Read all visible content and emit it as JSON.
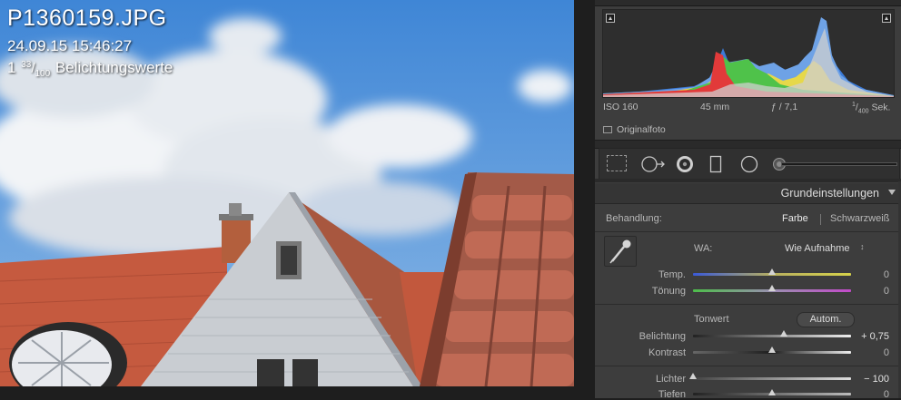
{
  "photo": {
    "filename": "P1360159.JPG",
    "datetime": "24.09.15 15:46:27",
    "exposure_whole": "1",
    "exposure_num": "33",
    "exposure_den": "100",
    "exposure_unit": "Belichtungswerte"
  },
  "histogram": {
    "iso": "ISO 160",
    "focal": "45 mm",
    "aperture": "ƒ / 7,1",
    "shutter_num": "1",
    "shutter_den": "400",
    "shutter_unit": "Sek.",
    "original_label": "Originalfoto"
  },
  "panel": {
    "section_title": "Grundeinstellungen",
    "treatment_label": "Behandlung:",
    "treatment_color": "Farbe",
    "treatment_bw": "Schwarzweiß",
    "wb_label": "WA:",
    "wb_value": "Wie Aufnahme",
    "wb_arrow": "↕",
    "tone_label": "Tonwert",
    "auto_button": "Autom.",
    "sliders": [
      {
        "label": "Temp.",
        "value": "0",
        "level": 0.5
      },
      {
        "label": "Tönung",
        "value": "0",
        "level": 0.5
      },
      {
        "label": "Belichtung",
        "value": "+ 0,75",
        "level": 0.575
      },
      {
        "label": "Kontrast",
        "value": "0",
        "level": 0.5
      },
      {
        "label": "Lichter",
        "value": "− 100",
        "level": 0.0
      },
      {
        "label": "Tiefen",
        "value": "0",
        "level": 0.5
      }
    ]
  },
  "colors": {
    "panel_bg": "#3d3d3d",
    "sky": "#4d8ed5",
    "roof": "#c4553c"
  }
}
